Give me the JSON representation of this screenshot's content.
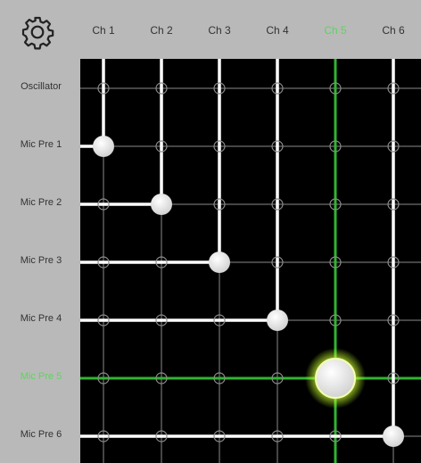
{
  "columns": [
    {
      "label": "Ch 1",
      "active": false
    },
    {
      "label": "Ch 2",
      "active": false
    },
    {
      "label": "Ch 3",
      "active": false
    },
    {
      "label": "Ch 4",
      "active": false
    },
    {
      "label": "Ch 5",
      "active": true
    },
    {
      "label": "Ch 6",
      "active": false
    }
  ],
  "rows": [
    {
      "label": "Oscillator",
      "active": false
    },
    {
      "label": "Mic Pre 1",
      "active": false
    },
    {
      "label": "Mic Pre 2",
      "active": false
    },
    {
      "label": "Mic Pre 3",
      "active": false
    },
    {
      "label": "Mic Pre 4",
      "active": false
    },
    {
      "label": "Mic Pre 5",
      "active": true
    },
    {
      "label": "Mic Pre 6",
      "active": false
    }
  ],
  "routes": [
    {
      "row": 1,
      "col": 0,
      "selected": false
    },
    {
      "row": 2,
      "col": 1,
      "selected": false
    },
    {
      "row": 3,
      "col": 2,
      "selected": false
    },
    {
      "row": 4,
      "col": 3,
      "selected": false
    },
    {
      "row": 5,
      "col": 4,
      "selected": true
    },
    {
      "row": 6,
      "col": 5,
      "selected": false
    }
  ],
  "colors": {
    "background": "#b9b9b9",
    "matrix": "#000000",
    "grid": "#8a8a8a",
    "route": "#ffffff",
    "active": "#5ed45e",
    "active_line": "#2fb52f",
    "glow": "#d7ff3c",
    "knob": "#e6e6e6"
  },
  "icons": {
    "settings": "gear-icon"
  }
}
